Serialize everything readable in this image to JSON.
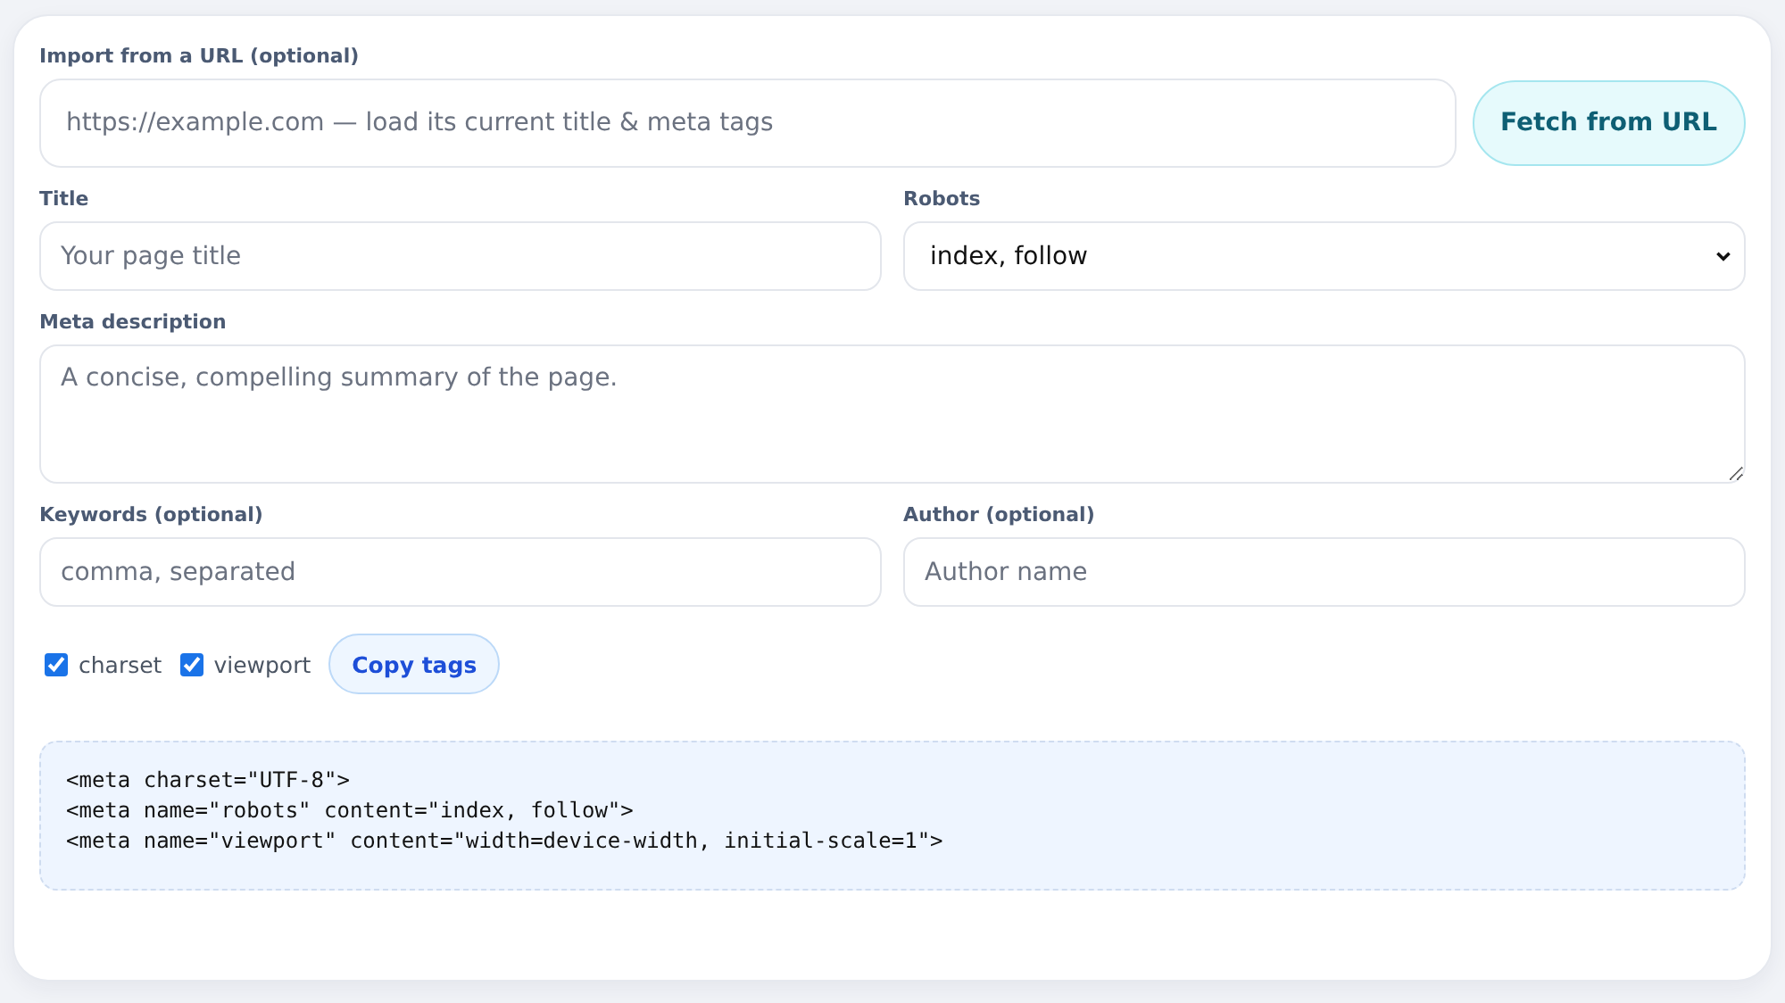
{
  "import": {
    "label": "Import from a URL (optional)",
    "placeholder": "https://example.com — load its current title & meta tags",
    "button": "Fetch from URL"
  },
  "title": {
    "label": "Title",
    "placeholder": "Your page title"
  },
  "robots": {
    "label": "Robots",
    "value": "index, follow"
  },
  "description": {
    "label": "Meta description",
    "placeholder": "A concise, compelling summary of the page."
  },
  "keywords": {
    "label": "Keywords (optional)",
    "placeholder": "comma, separated"
  },
  "author": {
    "label": "Author (optional)",
    "placeholder": "Author name"
  },
  "options": [
    {
      "label": "charset",
      "checked": true
    },
    {
      "label": "viewport",
      "checked": true
    }
  ],
  "copy_button": "Copy tags",
  "output_lines": [
    "<meta charset=\"UTF-8\">",
    "<meta name=\"robots\" content=\"index, follow\">",
    "<meta name=\"viewport\" content=\"width=device-width, initial-scale=1\">"
  ]
}
